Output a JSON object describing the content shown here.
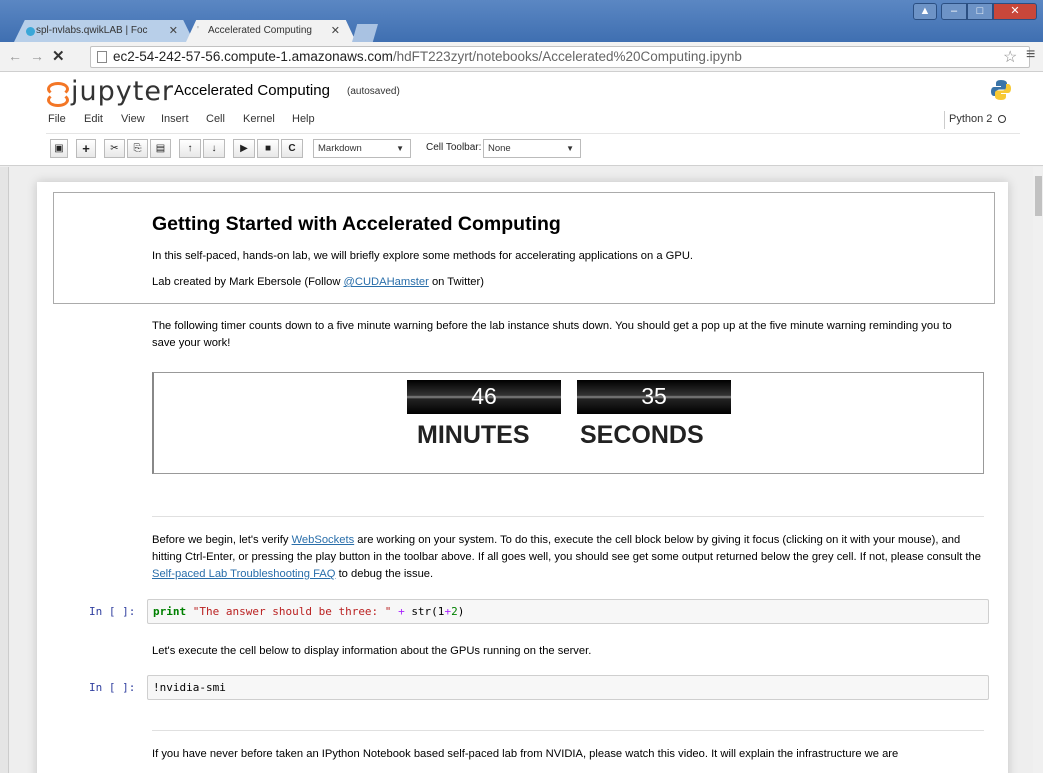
{
  "browser": {
    "tabs": [
      {
        "title": "spl-nvlabs.qwikLAB | Foc",
        "active": false
      },
      {
        "title": "Accelerated Computing",
        "active": true
      }
    ],
    "url_host": "ec2-54-242-57-56.compute-1.amazonaws.com",
    "url_path": "/hdFT223zyrt/notebooks/Accelerated%20Computing.ipynb"
  },
  "jupyter": {
    "logo_text": "jupyter",
    "notebook_name": "Accelerated Computing",
    "save_status": "(autosaved)",
    "menu": [
      "File",
      "Edit",
      "View",
      "Insert",
      "Cell",
      "Kernel",
      "Help"
    ],
    "kernel_name": "Python 2",
    "toolbar": {
      "cell_type": "Markdown",
      "cell_toolbar_label": "Cell Toolbar:",
      "cell_toolbar_value": "None"
    }
  },
  "notebook": {
    "title": "Getting Started with Accelerated Computing",
    "intro": "In this self-paced, hands-on lab, we will briefly explore some methods for accelerating applications on a GPU.",
    "credit_prefix": "Lab created by Mark Ebersole (Follow ",
    "credit_link": "@CUDAHamster",
    "credit_suffix": " on Twitter)",
    "timer_text": "The following timer counts down to a five minute warning before the lab instance shuts down. You should get a pop up at the five minute warning reminding you to save your work!",
    "timer": {
      "minutes": "46",
      "seconds": "35",
      "minutes_label": "MINUTES",
      "seconds_label": "SECONDS"
    },
    "websockets_p1": "Before we begin, let's verify ",
    "websockets_link": "WebSockets",
    "websockets_p2": " are working on your system. To do this, execute the cell block below by giving it focus (clicking on it with your mouse), and hitting Ctrl-Enter, or pressing the play button in the toolbar above. If all goes well, you should see get some output returned below the grey cell. If not, please consult the ",
    "faq_link": "Self-paced Lab Troubleshooting FAQ",
    "websockets_p3": " to debug the issue.",
    "prompt1": "In [ ]:",
    "code1_kw": "print",
    "code1_str": "\"The answer should be three: \"",
    "code1_op": "+",
    "code1_rest": "str(1",
    "code1_op2": "+",
    "code1_num": "2",
    "code1_end": ")",
    "gpu_text": "Let's execute the cell below to display information about the GPUs running on the server.",
    "prompt2": "In [ ]:",
    "code2": "!nvidia-smi",
    "video_text": "If you have never before taken an IPython Notebook based self-paced lab from NVIDIA, please watch this video. It will explain the infrastructure we are"
  }
}
